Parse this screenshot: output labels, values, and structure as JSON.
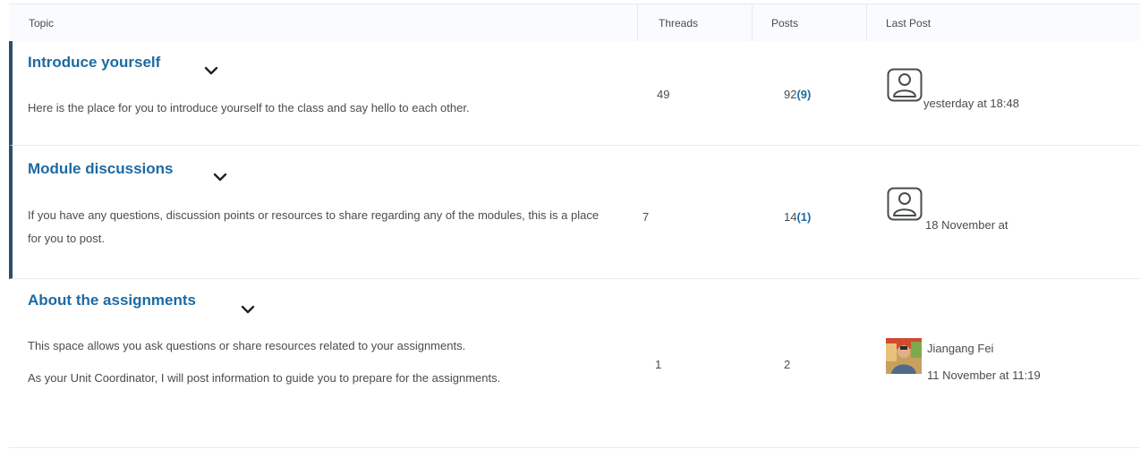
{
  "header": {
    "topic": "Topic",
    "threads": "Threads",
    "posts": "Posts",
    "last_post": "Last Post"
  },
  "topics": [
    {
      "title": "Introduce yourself",
      "description": [
        "Here is the place for you to introduce yourself to the class and say hello to each other."
      ],
      "threads": "49",
      "posts": "92",
      "unread": "(9)",
      "last_post_author": "",
      "last_post_time": "yesterday at 18:48",
      "avatar": "user-placeholder-icon"
    },
    {
      "title": "Module discussions",
      "description": [
        "If you have any questions, discussion points or resources to share regarding any of the modules, this is a place for you to post."
      ],
      "threads": "7",
      "posts": "14",
      "unread": "(1)",
      "last_post_author": "",
      "last_post_time": "18 November at",
      "avatar": "user-placeholder-icon"
    },
    {
      "title": "About the assignments",
      "description": [
        "This space allows you ask questions or share resources related to your assignments.",
        "As your Unit Coordinator, I will post information to guide you to prepare for the assignments."
      ],
      "threads": "1",
      "posts": "2",
      "unread": "",
      "last_post_author": "Jiangang Fei",
      "last_post_time": "11 November at 11:19",
      "avatar": "user-photo"
    }
  ],
  "colors": {
    "link": "#1c6aa3",
    "unread_bar": "#2a4e6f",
    "header_bg": "#f9fbff",
    "divider": "#e6eaf0"
  }
}
